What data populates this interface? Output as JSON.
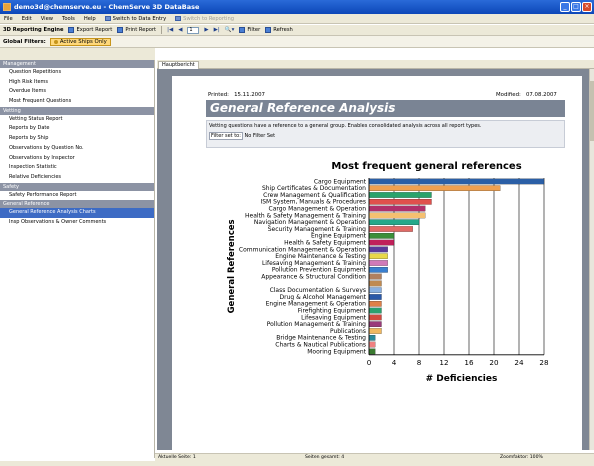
{
  "window": {
    "title": "demo3d@chemserve.eu - ChemServe 3D DataBase"
  },
  "menu": {
    "items": [
      "File",
      "Edit",
      "View",
      "Tools",
      "Help"
    ],
    "switch_entry": "Switch to Data Entry",
    "switch_reporting": "Switch to Reporting"
  },
  "toolbar": {
    "brand": "3D Reporting Engine",
    "export": "Export Report",
    "print": "Print Report",
    "page": "1",
    "filter": "Filter",
    "refresh": "Refresh"
  },
  "global_filters": {
    "label": "Global Filters:",
    "chip": "Active Ships Only"
  },
  "sidebar": [
    {
      "section": "Management",
      "items": [
        "Question Repetitions",
        "High Risk Items",
        "Overdue Items",
        "Most Frequent Questions"
      ]
    },
    {
      "section": "Vetting",
      "items": [
        "Vetting Status Report",
        "Reports by Date",
        "Reports by Ship",
        "Observations by Question No.",
        "Observations by Inspector",
        "Inspection Statistic",
        "Relative Deficiencies"
      ]
    },
    {
      "section": "Safety",
      "items": [
        "Safety Performance Report"
      ]
    },
    {
      "section": "General Reference",
      "items": [
        "General Reference Analysis Charts",
        "Insp Observations & Owner Comments"
      ]
    }
  ],
  "selected_item": "General Reference Analysis Charts",
  "tab": "Hauptbericht",
  "report": {
    "printed_label": "Printed:",
    "printed": "15.11.2007",
    "modified_label": "Modified:",
    "modified": "07.08.2007",
    "title": "General Reference Analysis",
    "description": "Vetting questions have a reference to a general group. Enables consolidated analysis across all report types.",
    "filter_label": "Filter set to:",
    "filter_value": "No Filter Set"
  },
  "chart_data": {
    "type": "bar",
    "orientation": "horizontal",
    "title": "Most frequent general references",
    "xlabel": "# Deficiencies",
    "ylabel": "General References",
    "xlim": [
      0,
      28
    ],
    "xticks": [
      0,
      4,
      8,
      12,
      16,
      20,
      24,
      28
    ],
    "grid": true,
    "categories": [
      "Cargo Equipment",
      "Ship Certificates & Documentation",
      "Crew Management & Qualification",
      "ISM System, Manuals & Procedures",
      "Cargo Management & Operation",
      "Health & Safety Management & Training",
      "Navigation Management & Operation",
      "Security Management & Training",
      "Engine Equipment",
      "Health & Safety Equipment",
      "Communication Management & Operation",
      "Engine Maintenance & Testing",
      "Lifesaving Management & Training",
      "Pollution Prevention Equipment",
      "Appearance & Structural Condition",
      "",
      "Class Documentation & Surveys",
      "Drug & Alcohol Management",
      "Engine Management & Operation",
      "Firefighting Equipment",
      "Lifesaving Equipment",
      "Pollution Management & Training",
      "Publications",
      "Bridge Maintenance & Testing",
      "Charts & Nautical Publications",
      "Mooring Equipment"
    ],
    "values": [
      28,
      21,
      10,
      10,
      9,
      9,
      8,
      7,
      4,
      4,
      3,
      3,
      3,
      3,
      2,
      2,
      2,
      2,
      2,
      2,
      2,
      2,
      2,
      1,
      1,
      1
    ],
    "colors": [
      "#2b5fa6",
      "#f0a050",
      "#2aa36b",
      "#e0504c",
      "#b0306a",
      "#f5c070",
      "#24a88a",
      "#e06a66",
      "#3b8f3a",
      "#c0205a",
      "#5a3a9a",
      "#e8d84a",
      "#d07ab8",
      "#3a7fcf",
      "#b08060",
      "#c08a50",
      "#8ab0e0",
      "#2a58a8",
      "#e08048",
      "#2aa070",
      "#d04a40",
      "#9a3a7a",
      "#f0b860",
      "#2a8a9a",
      "#f08080",
      "#3a7a30"
    ]
  },
  "status": {
    "current_page": "Aktuelle Seite: 1",
    "total_pages": "Seiten gesamt: 4",
    "zoom": "Zoomfaktor: 100%"
  }
}
